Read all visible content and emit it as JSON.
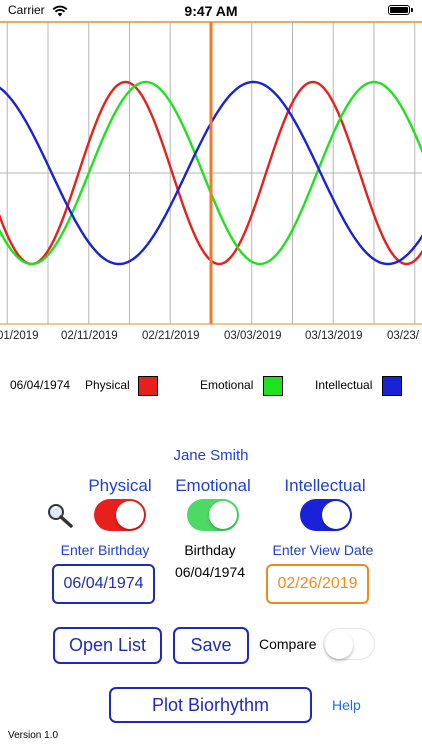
{
  "status_bar": {
    "carrier": "Carrier",
    "time": "9:47 AM"
  },
  "colors": {
    "physical": "#e8201c",
    "emotional": "#1fe21f",
    "intellectual": "#1a22d8",
    "marker": "#f07a2a",
    "button_blue": "#1f2bb8",
    "link_blue": "#1f6fe0",
    "toggle_off": "#e5e5ea"
  },
  "chart_data": {
    "type": "line",
    "x_tick_labels": [
      "01/2019",
      "02/11/2019",
      "02/21/2019",
      "03/03/2019",
      "03/13/2019",
      "03/23/"
    ],
    "series": [
      {
        "name": "Physical",
        "period_days": 23
      },
      {
        "name": "Emotional",
        "period_days": 28
      },
      {
        "name": "Intellectual",
        "period_days": 33
      }
    ],
    "view_date": "02/26/2019",
    "birthday": "06/04/1974",
    "grid": true
  },
  "legend": {
    "birthday": "06/04/1974",
    "physical": "Physical",
    "emotional": "Emotional",
    "intellectual": "Intellectual"
  },
  "controls": {
    "name": "Jane Smith",
    "physical_label": "Physical",
    "emotional_label": "Emotional",
    "intellectual_label": "Intellectual",
    "physical_on": true,
    "emotional_on": true,
    "intellectual_on": true,
    "enter_birthday_label": "Enter Birthday",
    "birthday_value": "06/04/1974",
    "birthday_caption": "Birthday",
    "birthday_display": "06/04/1974",
    "enter_view_date_label": "Enter View Date",
    "view_date_value": "02/26/2019",
    "open_list_label": "Open List",
    "save_label": "Save",
    "compare_label": "Compare",
    "compare_on": false,
    "plot_label": "Plot Biorhythm",
    "help_label": "Help",
    "version": "Version 1.0"
  }
}
